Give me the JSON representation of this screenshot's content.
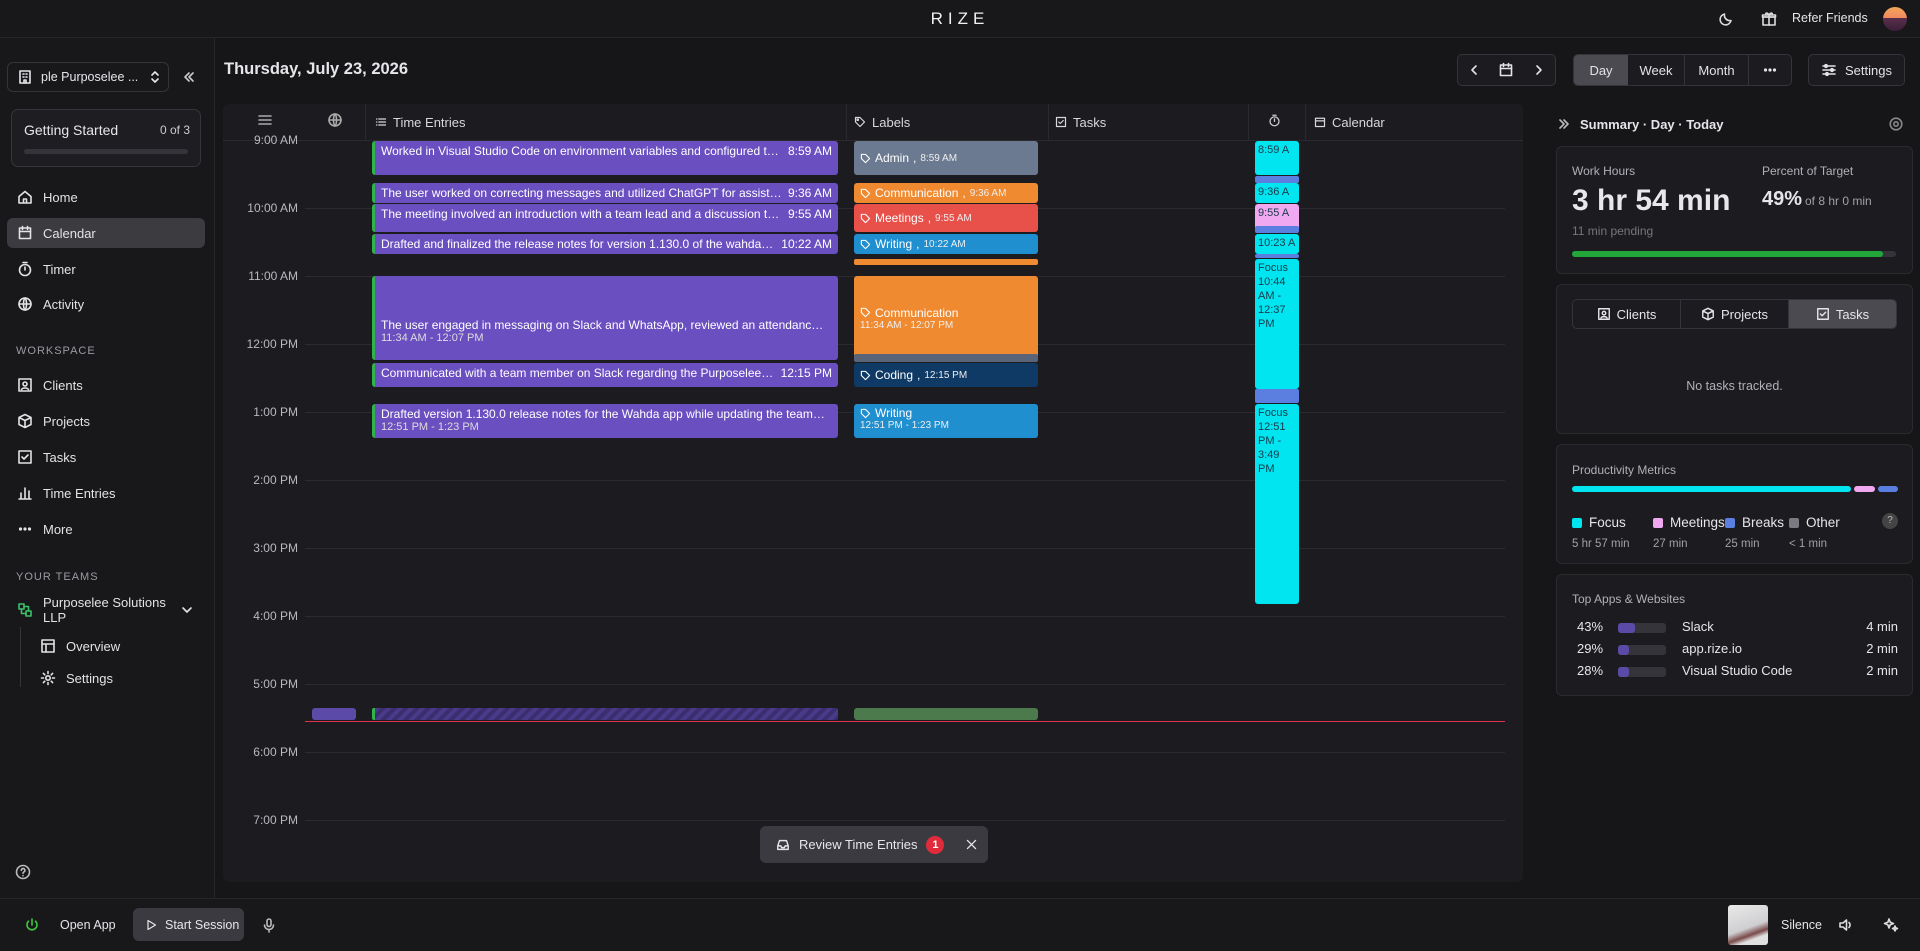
{
  "app": {
    "logo": "RIZE",
    "refer_label": "Refer Friends"
  },
  "sidebar": {
    "workspace_select": "ple Purposelee ...",
    "getting_started": {
      "title": "Getting Started",
      "progress": "0 of 3",
      "fraction": 0
    },
    "nav": [
      {
        "label": "Home",
        "icon": "home-icon"
      },
      {
        "label": "Calendar",
        "icon": "calendar-icon",
        "active": true
      },
      {
        "label": "Timer",
        "icon": "timer-icon"
      },
      {
        "label": "Activity",
        "icon": "globe-icon"
      }
    ],
    "workspace_title": "WORKSPACE",
    "workspace_nav": [
      {
        "label": "Clients",
        "icon": "clients-icon"
      },
      {
        "label": "Projects",
        "icon": "cube-icon"
      },
      {
        "label": "Tasks",
        "icon": "check-square-icon"
      },
      {
        "label": "Time Entries",
        "icon": "bar-chart-icon"
      },
      {
        "label": "More",
        "icon": "dots-icon"
      }
    ],
    "teams_title": "YOUR TEAMS",
    "team": {
      "name": "Purposelee Solutions LLP",
      "items": [
        "Overview",
        "Settings"
      ]
    }
  },
  "header": {
    "date": "Thursday, July 23, 2026",
    "views": [
      "Day",
      "Week",
      "Month"
    ],
    "active_view": "Day",
    "settings_label": "Settings"
  },
  "columns": {
    "time_entries": "Time Entries",
    "labels": "Labels",
    "tasks": "Tasks",
    "calendar": "Calendar"
  },
  "hours": [
    "9:00 AM",
    "10:00 AM",
    "11:00 AM",
    "12:00 PM",
    "1:00 PM",
    "2:00 PM",
    "3:00 PM",
    "4:00 PM",
    "5:00 PM",
    "6:00 PM",
    "7:00 PM"
  ],
  "entries": [
    {
      "text": "Worked in Visual Studio Code on environment variables and configured two-...",
      "time": "8:59 AM",
      "sub": ""
    },
    {
      "text": "The user worked on correcting messages and utilized ChatGPT for assistance.",
      "time": "9:36 AM",
      "sub": ""
    },
    {
      "text": "The meeting involved an introduction with a team lead and a discussion that ...",
      "time": "9:55 AM",
      "sub": ""
    },
    {
      "text": "Drafted and finalized the release notes for version 1.130.0 of the wahda-ap...",
      "time": "10:22 AM",
      "sub": ""
    },
    {
      "text": "The user engaged in messaging on Slack and WhatsApp, reviewed an attendance shee...",
      "time": "",
      "sub": "11:34 AM - 12:07 PM"
    },
    {
      "text": "Communicated with a team member on Slack regarding the Purposelee Inte...",
      "time": "12:15 PM",
      "sub": ""
    },
    {
      "text": "Drafted version 1.130.0 release notes for the Wahda app while updating the team att...",
      "time": "",
      "sub": "12:51 PM - 1:23 PM"
    }
  ],
  "labels": [
    {
      "name": "Admin",
      "time": "8:59 AM",
      "color": "#6b7a90"
    },
    {
      "name": "Communication",
      "time": "9:36 AM",
      "color": "#f08a30"
    },
    {
      "name": "Meetings",
      "time": "9:55 AM",
      "color": "#e8504a"
    },
    {
      "name": "Writing",
      "time": "10:22 AM",
      "color": "#1f8fd0"
    },
    {
      "name": "Communication",
      "time": "11:34 AM - 12:07 PM",
      "color": "#f08a30"
    },
    {
      "name": "Coding",
      "time": "12:15 PM",
      "color": "#0f3a66"
    },
    {
      "name": "Writing",
      "time": "12:51 PM - 1:23 PM",
      "color": "#1f8fd0"
    }
  ],
  "focus_blocks": [
    {
      "text": "8:59 A"
    },
    {
      "text": "9:36 A"
    },
    {
      "text": "9:55 A"
    },
    {
      "text": "10:23 A"
    },
    {
      "text": "Focus\n10:44 AM - 12:37 PM"
    },
    {
      "text": "Focus\n12:51 PM - 3:49 PM"
    }
  ],
  "summary": {
    "title": "Summary · Day · Today",
    "work_hours_label": "Work Hours",
    "work_hours": "3 hr 54 min",
    "pending": "11 min pending",
    "percent_label": "Percent of Target",
    "percent": "49%",
    "percent_of": "of 8 hr 0 min",
    "target_fraction": 0.96,
    "tabs": [
      "Clients",
      "Projects",
      "Tasks"
    ],
    "active_tab": "Tasks",
    "no_tasks": "No tasks tracked.",
    "productivity_title": "Productivity Metrics",
    "metrics": [
      {
        "name": "Focus",
        "value": "5 hr 57 min",
        "color": "#00e5f0"
      },
      {
        "name": "Meetings",
        "value": "27 min",
        "color": "#f0a8f0"
      },
      {
        "name": "Breaks",
        "value": "25 min",
        "color": "#5b7fe0"
      },
      {
        "name": "Other",
        "value": "< 1 min",
        "color": "#7a7a80"
      }
    ],
    "apps_title": "Top Apps & Websites",
    "apps": [
      {
        "pct": "43%",
        "name": "Slack",
        "time": "4 min",
        "fraction": 0.43
      },
      {
        "pct": "29%",
        "name": "app.rize.io",
        "time": "2 min",
        "fraction": 0.29
      },
      {
        "pct": "28%",
        "name": "Visual Studio Code",
        "time": "2 min",
        "fraction": 0.28
      }
    ]
  },
  "toast": {
    "label": "Review Time Entries",
    "count": "1"
  },
  "bottom": {
    "open_app": "Open App",
    "start_session": "Start Session",
    "sound": "Silence"
  }
}
